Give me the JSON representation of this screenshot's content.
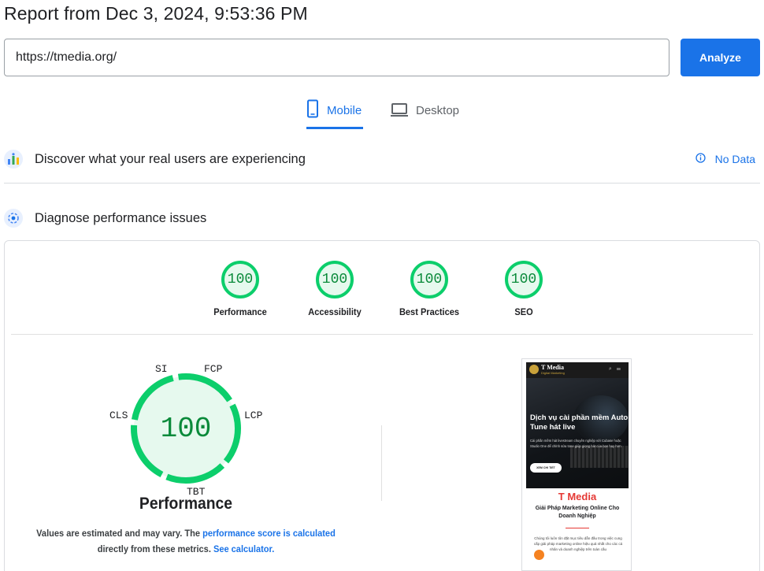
{
  "header": {
    "title": "Report from Dec 3, 2024, 9:53:36 PM"
  },
  "search": {
    "url_value": "https://tmedia.org/",
    "analyze_label": "Analyze"
  },
  "tabs": [
    {
      "label": "Mobile",
      "icon": "smartphone-icon",
      "active": true
    },
    {
      "label": "Desktop",
      "icon": "laptop-icon",
      "active": false
    }
  ],
  "field_data": {
    "title": "Discover what your real users are experiencing",
    "status": "No Data"
  },
  "lab_data": {
    "title": "Diagnose performance issues",
    "scores": [
      {
        "label": "Performance",
        "value": "100"
      },
      {
        "label": "Accessibility",
        "value": "100"
      },
      {
        "label": "Best Practices",
        "value": "100"
      },
      {
        "label": "SEO",
        "value": "100"
      }
    ],
    "performance": {
      "score": "100",
      "title": "Performance",
      "metrics": {
        "si": "SI",
        "fcp": "FCP",
        "lcp": "LCP",
        "tbt": "TBT",
        "cls": "CLS"
      },
      "disclaimer_1": "Values are estimated and may vary. The ",
      "disclaimer_link": "performance score is calculated",
      "disclaimer_2": " directly from these metrics. ",
      "disclaimer_link2": "See calculator."
    }
  },
  "screenshot": {
    "brand": "T Media",
    "brand_sub": "Digital Marketing",
    "hero_title": "Dịch vụ cài phần mềm Auto Tune hát live",
    "hero_text": "Cài phần mềm hát livestream chuyên nghiệp với Cubase hoặc Studio One để chỉnh sửa tone giúp giọng hát của bạn hay hơn",
    "hero_button": "XEM CHI TIẾT",
    "heading": "T Media",
    "subheading": "Giải Pháp Marketing Online Cho Doanh Nghiệp",
    "body": "Chúng tôi luôn tôn đặt mục tiêu dẫn đầu trong việc cung cấp giải pháp marketing online hiệu quả nhất cho các cá nhân và doanh nghiệp trên toàn cầu"
  },
  "colors": {
    "accent": "#1a73e8",
    "pass": "#0cce6b",
    "pass_text": "#0a8a3a",
    "pass_bg": "#e6f9ee"
  }
}
